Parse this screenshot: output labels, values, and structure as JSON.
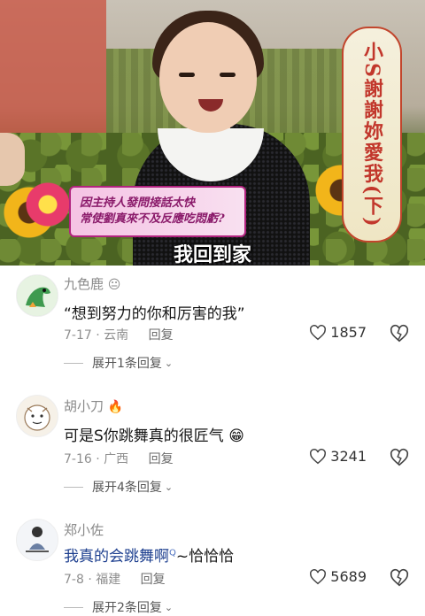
{
  "video": {
    "banner_line1": "因主持人發問接話太快",
    "banner_line2": "常使劉真來不及反應吃悶虧?",
    "side_title": "小S謝謝妳愛我(下)",
    "subtitle": "我回到家"
  },
  "comments": [
    {
      "username": "九色鹿",
      "badge": "😐",
      "content": "“想到努力的你和厉害的我”",
      "date_location": "7-17 · 云南",
      "reply_label": "回复",
      "likes": "1857",
      "expand_label": "展开1条回复"
    },
    {
      "username": "胡小刀",
      "badge": "🔥",
      "content": "可是S你跳舞真的很匠气",
      "content_emoji": "😁",
      "date_location": "7-16 · 广西",
      "reply_label": "回复",
      "likes": "3241",
      "expand_label": "展开4条回复"
    },
    {
      "username": "郑小佐",
      "content": "我真的会跳舞啊",
      "content_sup": "Q",
      "content_tail": "~恰恰恰",
      "date_location": "7-8 · 福建",
      "reply_label": "回复",
      "likes": "5689",
      "expand_label": "展开2条回复"
    }
  ],
  "icons": {
    "like": "heart-outline-icon",
    "dislike": "broken-heart-icon",
    "expand": "chevron-down-icon"
  },
  "colors": {
    "text_primary": "#161616",
    "text_secondary": "#8f8f8f",
    "banner_text": "#8a1a6a",
    "side_title_text": "#c2372c"
  }
}
